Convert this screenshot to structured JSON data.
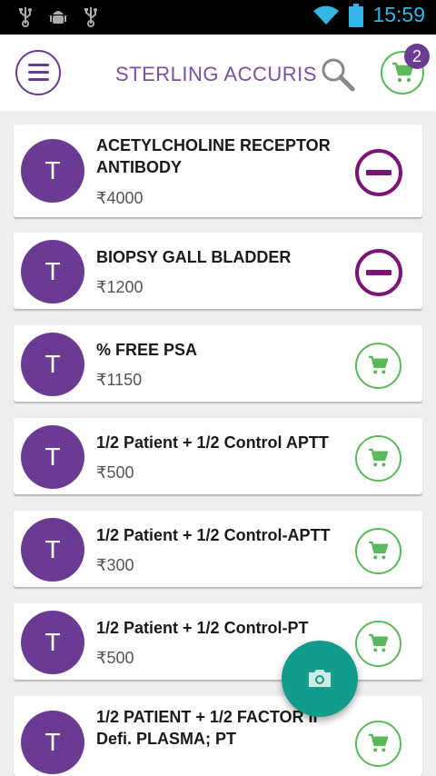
{
  "status_bar": {
    "time": "15:59"
  },
  "app_bar": {
    "title": "STERLING ACCURIS",
    "cart_count": "2"
  },
  "items": [
    {
      "avatar": "T",
      "name": "ACETYLCHOLINE RECEPTOR ANTIBODY",
      "price": "₹4000",
      "in_cart": true
    },
    {
      "avatar": "T",
      "name": "BIOPSY GALL BLADDER",
      "price": "₹1200",
      "in_cart": true
    },
    {
      "avatar": "T",
      "name": "% FREE PSA",
      "price": "₹1150",
      "in_cart": false
    },
    {
      "avatar": "T",
      "name": "1/2 Patient + 1/2 Control APTT",
      "price": "₹500",
      "in_cart": false
    },
    {
      "avatar": "T",
      "name": "1/2 Patient + 1/2 Control-APTT",
      "price": "₹300",
      "in_cart": false
    },
    {
      "avatar": "T",
      "name": "1/2 Patient + 1/2 Control-PT",
      "price": "₹500",
      "in_cart": false
    },
    {
      "avatar": "T",
      "name": "1/2 PATIENT + 1/2 FACTOR II Defi. PLASMA; PT",
      "price": "",
      "in_cart": false
    }
  ],
  "colors": {
    "primary": "#6b3a93",
    "accent_green": "#5cb85c",
    "remove": "#7b1575",
    "fab": "#139c8c"
  },
  "icons": {
    "status_left": [
      "usb-icon",
      "android-debug-icon",
      "usb-icon"
    ],
    "status_right": [
      "wifi-icon",
      "battery-icon"
    ],
    "menu": "hamburger-menu-icon",
    "search": "search-icon",
    "cart": "cart-icon",
    "remove": "remove-circle-icon",
    "add": "add-to-cart-icon",
    "fab": "camera-icon"
  }
}
